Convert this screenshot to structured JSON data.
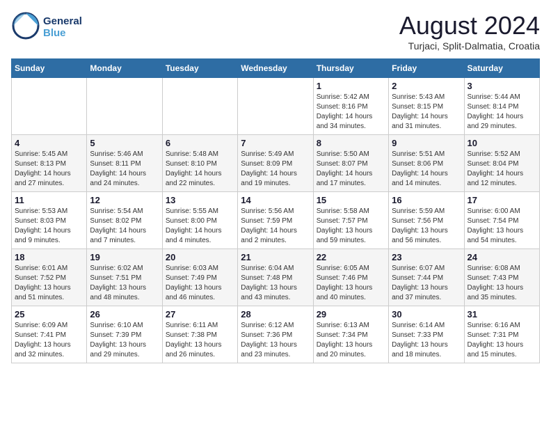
{
  "header": {
    "logo_line1": "General",
    "logo_line2": "Blue",
    "month": "August 2024",
    "location": "Turjaci, Split-Dalmatia, Croatia"
  },
  "weekdays": [
    "Sunday",
    "Monday",
    "Tuesday",
    "Wednesday",
    "Thursday",
    "Friday",
    "Saturday"
  ],
  "weeks": [
    [
      {
        "day": "",
        "info": ""
      },
      {
        "day": "",
        "info": ""
      },
      {
        "day": "",
        "info": ""
      },
      {
        "day": "",
        "info": ""
      },
      {
        "day": "1",
        "info": "Sunrise: 5:42 AM\nSunset: 8:16 PM\nDaylight: 14 hours\nand 34 minutes."
      },
      {
        "day": "2",
        "info": "Sunrise: 5:43 AM\nSunset: 8:15 PM\nDaylight: 14 hours\nand 31 minutes."
      },
      {
        "day": "3",
        "info": "Sunrise: 5:44 AM\nSunset: 8:14 PM\nDaylight: 14 hours\nand 29 minutes."
      }
    ],
    [
      {
        "day": "4",
        "info": "Sunrise: 5:45 AM\nSunset: 8:13 PM\nDaylight: 14 hours\nand 27 minutes."
      },
      {
        "day": "5",
        "info": "Sunrise: 5:46 AM\nSunset: 8:11 PM\nDaylight: 14 hours\nand 24 minutes."
      },
      {
        "day": "6",
        "info": "Sunrise: 5:48 AM\nSunset: 8:10 PM\nDaylight: 14 hours\nand 22 minutes."
      },
      {
        "day": "7",
        "info": "Sunrise: 5:49 AM\nSunset: 8:09 PM\nDaylight: 14 hours\nand 19 minutes."
      },
      {
        "day": "8",
        "info": "Sunrise: 5:50 AM\nSunset: 8:07 PM\nDaylight: 14 hours\nand 17 minutes."
      },
      {
        "day": "9",
        "info": "Sunrise: 5:51 AM\nSunset: 8:06 PM\nDaylight: 14 hours\nand 14 minutes."
      },
      {
        "day": "10",
        "info": "Sunrise: 5:52 AM\nSunset: 8:04 PM\nDaylight: 14 hours\nand 12 minutes."
      }
    ],
    [
      {
        "day": "11",
        "info": "Sunrise: 5:53 AM\nSunset: 8:03 PM\nDaylight: 14 hours\nand 9 minutes."
      },
      {
        "day": "12",
        "info": "Sunrise: 5:54 AM\nSunset: 8:02 PM\nDaylight: 14 hours\nand 7 minutes."
      },
      {
        "day": "13",
        "info": "Sunrise: 5:55 AM\nSunset: 8:00 PM\nDaylight: 14 hours\nand 4 minutes."
      },
      {
        "day": "14",
        "info": "Sunrise: 5:56 AM\nSunset: 7:59 PM\nDaylight: 14 hours\nand 2 minutes."
      },
      {
        "day": "15",
        "info": "Sunrise: 5:58 AM\nSunset: 7:57 PM\nDaylight: 13 hours\nand 59 minutes."
      },
      {
        "day": "16",
        "info": "Sunrise: 5:59 AM\nSunset: 7:56 PM\nDaylight: 13 hours\nand 56 minutes."
      },
      {
        "day": "17",
        "info": "Sunrise: 6:00 AM\nSunset: 7:54 PM\nDaylight: 13 hours\nand 54 minutes."
      }
    ],
    [
      {
        "day": "18",
        "info": "Sunrise: 6:01 AM\nSunset: 7:52 PM\nDaylight: 13 hours\nand 51 minutes."
      },
      {
        "day": "19",
        "info": "Sunrise: 6:02 AM\nSunset: 7:51 PM\nDaylight: 13 hours\nand 48 minutes."
      },
      {
        "day": "20",
        "info": "Sunrise: 6:03 AM\nSunset: 7:49 PM\nDaylight: 13 hours\nand 46 minutes."
      },
      {
        "day": "21",
        "info": "Sunrise: 6:04 AM\nSunset: 7:48 PM\nDaylight: 13 hours\nand 43 minutes."
      },
      {
        "day": "22",
        "info": "Sunrise: 6:05 AM\nSunset: 7:46 PM\nDaylight: 13 hours\nand 40 minutes."
      },
      {
        "day": "23",
        "info": "Sunrise: 6:07 AM\nSunset: 7:44 PM\nDaylight: 13 hours\nand 37 minutes."
      },
      {
        "day": "24",
        "info": "Sunrise: 6:08 AM\nSunset: 7:43 PM\nDaylight: 13 hours\nand 35 minutes."
      }
    ],
    [
      {
        "day": "25",
        "info": "Sunrise: 6:09 AM\nSunset: 7:41 PM\nDaylight: 13 hours\nand 32 minutes."
      },
      {
        "day": "26",
        "info": "Sunrise: 6:10 AM\nSunset: 7:39 PM\nDaylight: 13 hours\nand 29 minutes."
      },
      {
        "day": "27",
        "info": "Sunrise: 6:11 AM\nSunset: 7:38 PM\nDaylight: 13 hours\nand 26 minutes."
      },
      {
        "day": "28",
        "info": "Sunrise: 6:12 AM\nSunset: 7:36 PM\nDaylight: 13 hours\nand 23 minutes."
      },
      {
        "day": "29",
        "info": "Sunrise: 6:13 AM\nSunset: 7:34 PM\nDaylight: 13 hours\nand 20 minutes."
      },
      {
        "day": "30",
        "info": "Sunrise: 6:14 AM\nSunset: 7:33 PM\nDaylight: 13 hours\nand 18 minutes."
      },
      {
        "day": "31",
        "info": "Sunrise: 6:16 AM\nSunset: 7:31 PM\nDaylight: 13 hours\nand 15 minutes."
      }
    ]
  ]
}
